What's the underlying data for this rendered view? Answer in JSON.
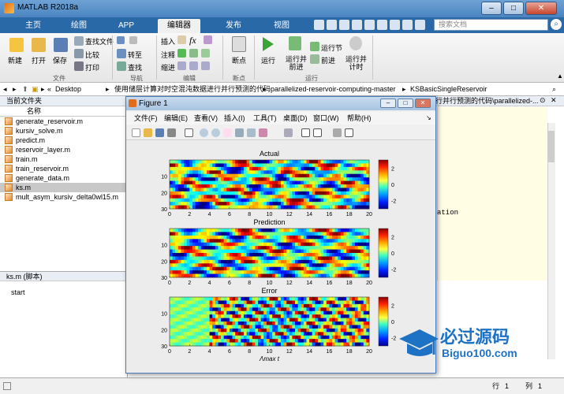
{
  "window": {
    "title": "MATLAB R2018a",
    "min": "–",
    "max": "□",
    "close": "✕"
  },
  "tabs": [
    "主页",
    "绘图",
    "APP",
    "编辑器",
    "发布",
    "视图"
  ],
  "search": {
    "placeholder": "搜索文档"
  },
  "ribbon": {
    "file": {
      "new": "新建",
      "open": "打开",
      "save": "保存",
      "find_files": "查找文件",
      "compare": "比较",
      "print": "打印",
      "label": "文件"
    },
    "nav": {
      "goto": "转至",
      "find": "查找",
      "label": "导航"
    },
    "edit": {
      "insert": "插入",
      "comment": "注释",
      "indent": "缩进",
      "fx": "fx",
      "label": "编辑"
    },
    "breakpoints": {
      "label": "断点",
      "sub": "断点"
    },
    "run": {
      "run": "运行",
      "run_advance": "运行并\n前进",
      "run_section": "运行节",
      "advance": "前进",
      "run_time": "运行并\n计时",
      "label": "运行"
    }
  },
  "address": {
    "path": [
      "Desktop",
      "使用储层计算对时空混沌数据进行并行预测的代码",
      "parallelized-reservoir-computing-master",
      "KSBasicSingleReservoir"
    ]
  },
  "current_folder": {
    "header": "当前文件夹",
    "col": "名称",
    "files": [
      "generate_reservoir.m",
      "kursiv_solve.m",
      "predict.m",
      "reservoir_layer.m",
      "train.m",
      "train_reservoir.m",
      "generate_data.m",
      "ks.m",
      "mult_asym_kursiv_delta0wl15.m"
    ],
    "selected_index": 7
  },
  "details": {
    "title": "ks.m  (脚本)",
    "content": "start"
  },
  "editor": {
    "tab_text": "行并行预测的代码\\parallelized-...",
    "snippet": "ation"
  },
  "status": {
    "row_label": "行",
    "row": "1",
    "col_label": "列",
    "col": "1"
  },
  "figure": {
    "title": "Figure 1",
    "menu": [
      "文件(F)",
      "编辑(E)",
      "查看(V)",
      "插入(I)",
      "工具(T)",
      "桌面(D)",
      "窗口(W)",
      "帮助(H)"
    ]
  },
  "chart_data": [
    {
      "type": "heatmap",
      "title": "Actual",
      "x": {
        "ticks": [
          0,
          2,
          4,
          6,
          8,
          10,
          12,
          14,
          16,
          18,
          20
        ],
        "range": [
          0,
          20
        ]
      },
      "y": {
        "ticks": [
          10,
          20,
          30
        ],
        "range": [
          0,
          30
        ]
      },
      "colorbar": {
        "ticks": [
          2,
          0,
          -2
        ],
        "range": [
          -3,
          3
        ]
      }
    },
    {
      "type": "heatmap",
      "title": "Prediction",
      "x": {
        "ticks": [
          0,
          2,
          4,
          6,
          8,
          10,
          12,
          14,
          16,
          18,
          20
        ],
        "range": [
          0,
          20
        ]
      },
      "y": {
        "ticks": [
          10,
          20,
          30
        ],
        "range": [
          0,
          30
        ]
      },
      "colorbar": {
        "ticks": [
          2,
          0,
          -2
        ],
        "range": [
          -3,
          3
        ]
      }
    },
    {
      "type": "heatmap",
      "title": "Error",
      "x": {
        "ticks": [
          0,
          2,
          4,
          6,
          8,
          10,
          12,
          14,
          16,
          18,
          20
        ],
        "range": [
          0,
          20
        ]
      },
      "y": {
        "ticks": [
          10,
          20,
          30
        ],
        "range": [
          0,
          30
        ]
      },
      "xlabel": "Λmax t",
      "colorbar": {
        "ticks": [
          2,
          0,
          -2
        ],
        "range": [
          -3,
          3
        ]
      }
    }
  ],
  "watermark": {
    "brand": "必过源码",
    "url": "Biguo100.com"
  }
}
